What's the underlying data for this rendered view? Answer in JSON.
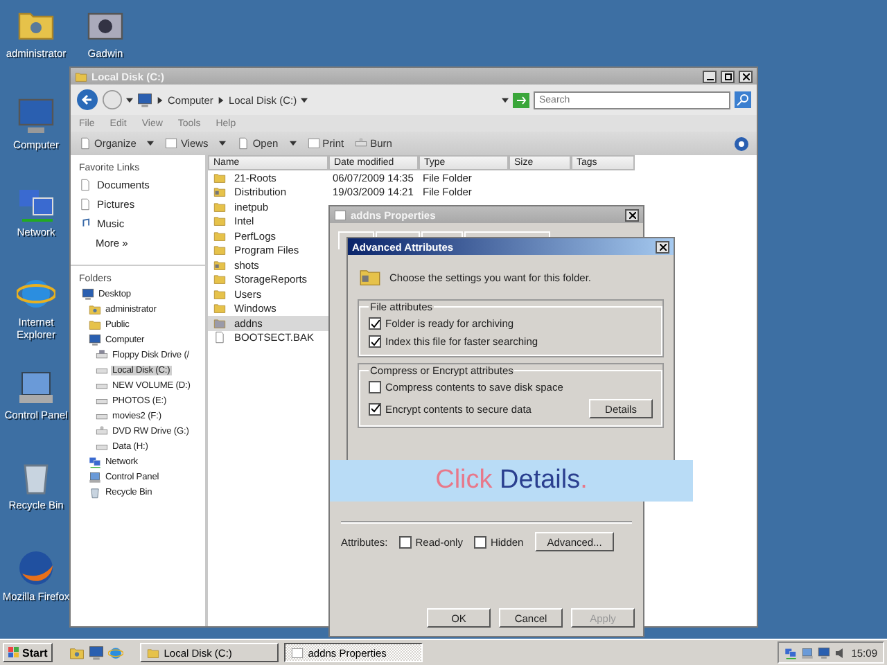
{
  "desktop_icons": [
    {
      "label": "administrator",
      "kind": "user"
    },
    {
      "label": "Gadwin",
      "kind": "camera"
    },
    {
      "label": "Computer",
      "kind": "computer"
    },
    {
      "label": "Network",
      "kind": "network"
    },
    {
      "label": "Internet Explorer",
      "kind": "browser"
    },
    {
      "label": "Control Panel",
      "kind": "control"
    },
    {
      "label": "Recycle Bin",
      "kind": "bin"
    },
    {
      "label": "Mozilla Firefox",
      "kind": "globe"
    }
  ],
  "explorer": {
    "title": "Local Disk (C:)",
    "address": [
      "Computer",
      "Local Disk (C:)"
    ],
    "search": {
      "placeholder": "Search"
    },
    "menu": [
      "File",
      "Edit",
      "View",
      "Tools",
      "Help"
    ],
    "toolbar": [
      {
        "label": "Organize",
        "kind": "organize",
        "dropdown": true
      },
      {
        "label": "Views",
        "kind": "views",
        "dropdown": true
      },
      {
        "label": "Open",
        "kind": "open",
        "dropdown": true
      },
      {
        "label": "Print",
        "kind": "print",
        "dropdown": false
      },
      {
        "label": "Burn",
        "kind": "burn",
        "dropdown": false
      }
    ],
    "favorite_links": {
      "title": "Favorite Links",
      "items": [
        {
          "label": "Documents",
          "kind": "document"
        },
        {
          "label": "Pictures",
          "kind": "document"
        },
        {
          "label": "Music",
          "kind": "music"
        }
      ],
      "more": "More »"
    },
    "folders": {
      "title": "Folders",
      "tree": [
        {
          "label": "Desktop",
          "kind": "desktop",
          "selected": false,
          "children": [
            {
              "label": "administrator",
              "kind": "user",
              "selected": false
            },
            {
              "label": "Public",
              "kind": "folder",
              "selected": false
            },
            {
              "label": "Computer",
              "kind": "computer",
              "selected": false,
              "children": [
                {
                  "label": "Floppy Disk Drive (/",
                  "kind": "floppy",
                  "selected": false
                },
                {
                  "label": "Local Disk (C:)",
                  "kind": "drive",
                  "selected": true
                },
                {
                  "label": "NEW VOLUME (D:)",
                  "kind": "drive",
                  "selected": false
                },
                {
                  "label": "PHOTOS (E:)",
                  "kind": "drive",
                  "selected": false
                },
                {
                  "label": "movies2 (F:)",
                  "kind": "drive",
                  "selected": false
                },
                {
                  "label": "DVD RW Drive (G:)",
                  "kind": "dvd",
                  "selected": false
                },
                {
                  "label": "Data (H:)",
                  "kind": "drive",
                  "selected": false
                }
              ]
            },
            {
              "label": "Network",
              "kind": "network",
              "selected": false
            },
            {
              "label": "Control Panel",
              "kind": "control",
              "selected": false
            },
            {
              "label": "Recycle Bin",
              "kind": "bin",
              "selected": false
            }
          ]
        }
      ]
    },
    "columns": [
      "Name",
      "Date modified",
      "Type",
      "Size",
      "Tags"
    ],
    "rows": [
      {
        "name": "21-Roots",
        "date": "06/07/2009 14:35",
        "type": "File Folder",
        "kind": "folder",
        "selected": false
      },
      {
        "name": "Distribution",
        "date": "19/03/2009 14:21",
        "type": "File Folder",
        "kind": "special",
        "selected": false
      },
      {
        "name": "inetpub",
        "kind": "folder",
        "selected": false
      },
      {
        "name": "Intel",
        "kind": "folder",
        "selected": false
      },
      {
        "name": "PerfLogs",
        "kind": "folder",
        "selected": false
      },
      {
        "name": "Program Files",
        "kind": "folder",
        "selected": false
      },
      {
        "name": "shots",
        "kind": "special",
        "selected": false
      },
      {
        "name": "StorageReports",
        "kind": "folder",
        "selected": false
      },
      {
        "name": "Users",
        "kind": "folder",
        "selected": false
      },
      {
        "name": "Windows",
        "kind": "folder",
        "selected": false
      },
      {
        "name": "addns",
        "kind": "locked",
        "selected": true
      },
      {
        "name": "BOOTSECT.BAK",
        "kind": "file",
        "selected": false
      }
    ]
  },
  "properties": {
    "title": "addns Properties",
    "attributes_label": "Attributes:",
    "checkboxes": [
      {
        "label": "Read-only",
        "checked": false
      },
      {
        "label": "Hidden",
        "checked": false
      }
    ],
    "advanced_button": "Advanced...",
    "buttons": [
      {
        "label": "OK",
        "disabled": false
      },
      {
        "label": "Cancel",
        "disabled": false
      },
      {
        "label": "Apply",
        "disabled": true
      }
    ]
  },
  "advanced": {
    "title": "Advanced Attributes",
    "prompt": "Choose the settings you want for this folder.",
    "groups": [
      {
        "title": "File attributes",
        "options": [
          {
            "label": "Folder is ready for archiving",
            "checked": true
          },
          {
            "label": "Index this file for faster searching",
            "checked": true
          }
        ]
      },
      {
        "title": "Compress or Encrypt attributes",
        "options": [
          {
            "label": "Compress contents to save disk space",
            "checked": false
          },
          {
            "label": "Encrypt contents to secure data",
            "checked": true
          }
        ]
      }
    ],
    "details_button": "Details"
  },
  "callout": {
    "parts": [
      {
        "text": "Click",
        "color": "#e8788a"
      },
      {
        "text": "Details",
        "color": "#2a3f8f"
      },
      {
        "text": ".",
        "color": "#e8788a"
      }
    ]
  },
  "taskbar": {
    "start": "Start",
    "tasks": [
      {
        "label": "Local Disk (C:)",
        "kind": "folder",
        "selected": false
      },
      {
        "label": "addns Properties",
        "kind": "blank",
        "selected": true
      }
    ],
    "clock": "15:09"
  }
}
